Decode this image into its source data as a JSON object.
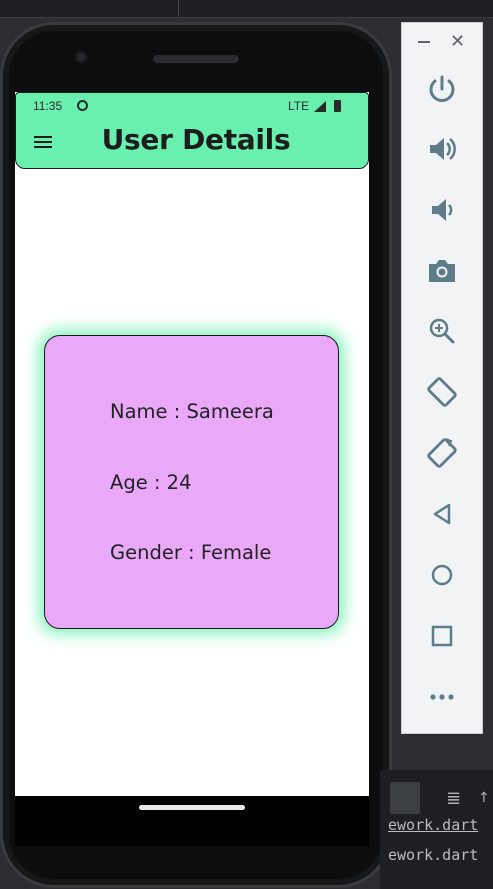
{
  "status_bar": {
    "time": "11:35",
    "network": "LTE",
    "icons": [
      "data-sync-icon",
      "signal-icon",
      "battery-icon"
    ]
  },
  "app_bar": {
    "title": "User Details",
    "menu_icon": "hamburger-menu-icon",
    "color": "#69f0ae"
  },
  "card": {
    "name_line": "Name : Sameera",
    "age_line": "Age : 24",
    "gender_line": "Gender : Female",
    "color": "#eaa9f8",
    "glow_color": "#69f0ae"
  },
  "emulator_toolbar": {
    "buttons": [
      "power-icon",
      "volume-up-icon",
      "volume-down-icon",
      "camera-icon",
      "zoom-icon",
      "rotate-left-icon",
      "rotate-right-icon",
      "back-icon",
      "home-icon",
      "overview-icon",
      "more-icon"
    ],
    "icon_color": "#5f7c8a"
  },
  "ide": {
    "code_line_1": "ework.dart",
    "code_line_2": "ework.dart"
  }
}
